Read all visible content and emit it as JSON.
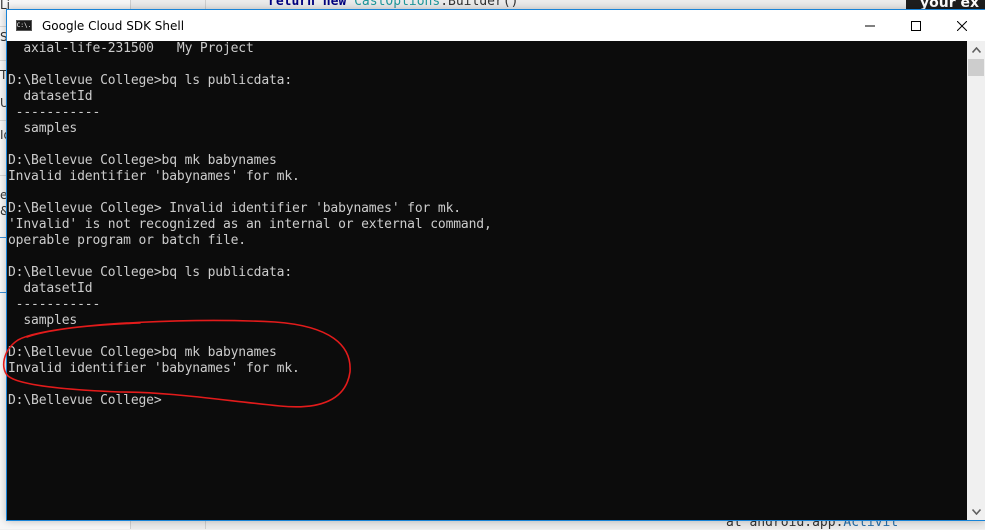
{
  "background": {
    "code_top": {
      "keyword_return": "return",
      "keyword_new": "new",
      "class": "CastOptions",
      "rest": ".Builder()"
    },
    "code_bottom": {
      "prefix": "at android.app.",
      "class": "Activit"
    },
    "dark_tab_text": "your ex",
    "left_panel_chars": [
      "Li",
      "S",
      "Ta",
      "Us",
      "Id",
      "ea",
      "&"
    ]
  },
  "window": {
    "title": "Google Cloud SDK Shell",
    "icon": "cmd-icon",
    "icon_text": "C:\\.",
    "controls": {
      "minimize": "minimize-icon",
      "maximize": "maximize-icon",
      "close": "close-icon"
    }
  },
  "console": {
    "lines": [
      "  axial-life-231500   My Project",
      "",
      "D:\\Bellevue College>bq ls publicdata:",
      "  datasetId",
      " -----------",
      "  samples",
      "",
      "D:\\Bellevue College>bq mk babynames",
      "Invalid identifier 'babynames' for mk.",
      "",
      "D:\\Bellevue College> Invalid identifier 'babynames' for mk.",
      "'Invalid' is not recognized as an internal or external command,",
      "operable program or batch file.",
      "",
      "D:\\Bellevue College>bq ls publicdata:",
      "  datasetId",
      " -----------",
      "  samples",
      "",
      "D:\\Bellevue College>bq mk babynames",
      "Invalid identifier 'babynames' for mk.",
      "",
      "D:\\Bellevue College>"
    ]
  },
  "annotation": {
    "type": "hand-drawn-ellipse",
    "color": "#e31b1b",
    "encloses_lines": [
      19,
      20
    ]
  },
  "colors": {
    "console_bg": "#0c0c0c",
    "console_fg": "#cccccc",
    "window_border": "#1883d7",
    "titlebar_bg": "#ffffff"
  }
}
